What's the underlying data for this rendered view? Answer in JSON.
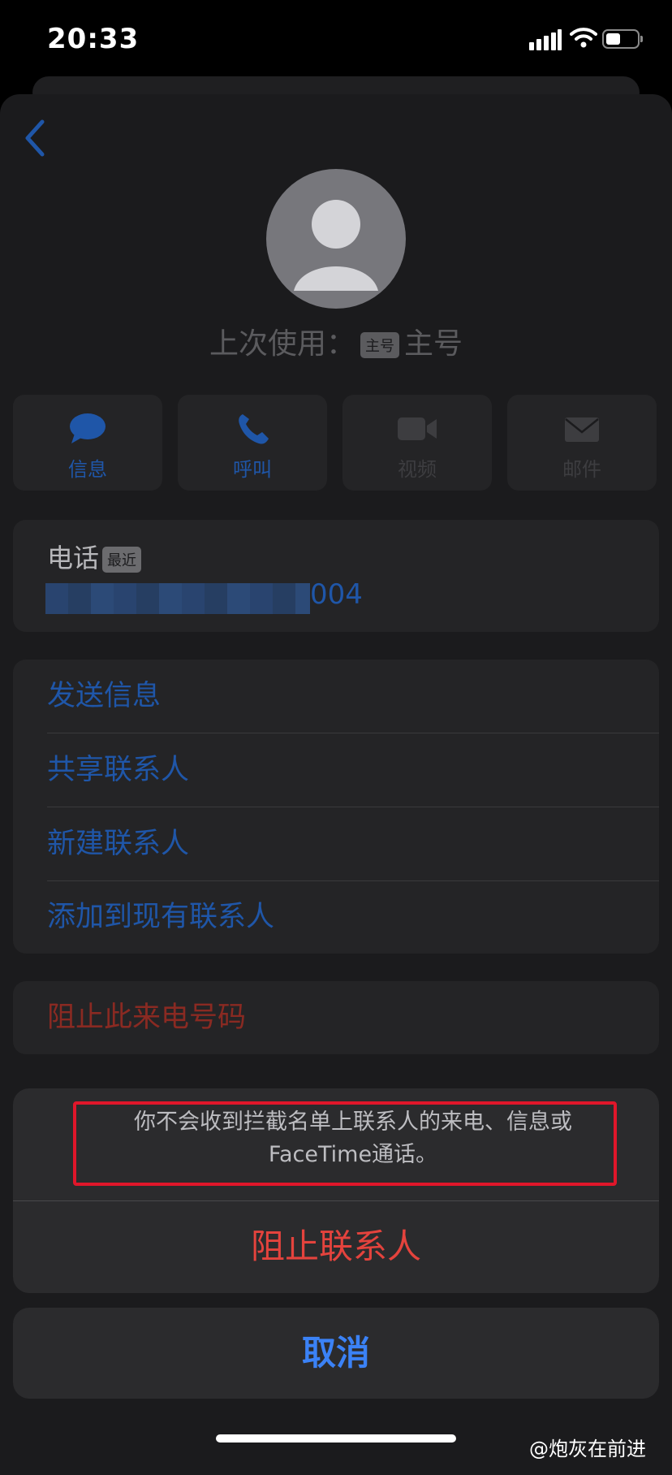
{
  "status_bar": {
    "time": "20:33"
  },
  "contact": {
    "last_used_label": "上次使用：",
    "last_used_badge": "主号",
    "last_used_value": "主号"
  },
  "quick_actions": [
    {
      "label": "信息",
      "icon": "message-icon",
      "enabled": true
    },
    {
      "label": "呼叫",
      "icon": "phone-icon",
      "enabled": true
    },
    {
      "label": "视频",
      "icon": "video-icon",
      "enabled": false
    },
    {
      "label": "邮件",
      "icon": "mail-icon",
      "enabled": false
    }
  ],
  "phone": {
    "label": "电话",
    "badge": "最近",
    "number_suffix": "004"
  },
  "actions": [
    {
      "label": "发送信息"
    },
    {
      "label": "共享联系人"
    },
    {
      "label": "新建联系人"
    },
    {
      "label": "添加到现有联系人"
    }
  ],
  "block_number": {
    "label": "阻止此来电号码"
  },
  "action_sheet": {
    "message": "你不会收到拦截名单上联系人的来电、信息或FaceTime通话。",
    "confirm_label": "阻止联系人",
    "cancel_label": "取消"
  },
  "colors": {
    "accent_blue": "#1f56a8",
    "destructive_red": "#e4433d",
    "cancel_blue": "#3b82f6",
    "highlight_red": "#e0162a"
  },
  "watermark": "@炮灰在前进"
}
